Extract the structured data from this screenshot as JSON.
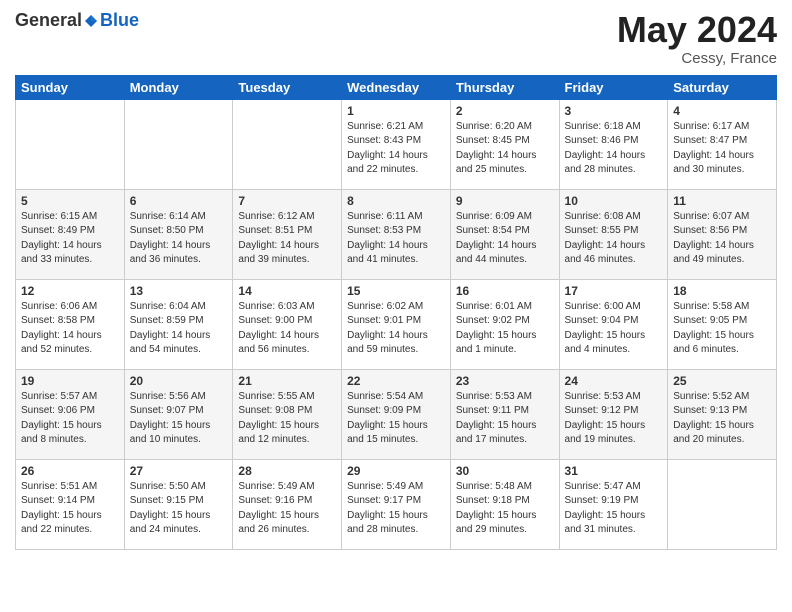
{
  "header": {
    "logo_general": "General",
    "logo_blue": "Blue",
    "month_year": "May 2024",
    "location": "Cessy, France"
  },
  "days_of_week": [
    "Sunday",
    "Monday",
    "Tuesday",
    "Wednesday",
    "Thursday",
    "Friday",
    "Saturday"
  ],
  "weeks": [
    [
      {
        "day": "",
        "info": ""
      },
      {
        "day": "",
        "info": ""
      },
      {
        "day": "",
        "info": ""
      },
      {
        "day": "1",
        "info": "Sunrise: 6:21 AM\nSunset: 8:43 PM\nDaylight: 14 hours\nand 22 minutes."
      },
      {
        "day": "2",
        "info": "Sunrise: 6:20 AM\nSunset: 8:45 PM\nDaylight: 14 hours\nand 25 minutes."
      },
      {
        "day": "3",
        "info": "Sunrise: 6:18 AM\nSunset: 8:46 PM\nDaylight: 14 hours\nand 28 minutes."
      },
      {
        "day": "4",
        "info": "Sunrise: 6:17 AM\nSunset: 8:47 PM\nDaylight: 14 hours\nand 30 minutes."
      }
    ],
    [
      {
        "day": "5",
        "info": "Sunrise: 6:15 AM\nSunset: 8:49 PM\nDaylight: 14 hours\nand 33 minutes."
      },
      {
        "day": "6",
        "info": "Sunrise: 6:14 AM\nSunset: 8:50 PM\nDaylight: 14 hours\nand 36 minutes."
      },
      {
        "day": "7",
        "info": "Sunrise: 6:12 AM\nSunset: 8:51 PM\nDaylight: 14 hours\nand 39 minutes."
      },
      {
        "day": "8",
        "info": "Sunrise: 6:11 AM\nSunset: 8:53 PM\nDaylight: 14 hours\nand 41 minutes."
      },
      {
        "day": "9",
        "info": "Sunrise: 6:09 AM\nSunset: 8:54 PM\nDaylight: 14 hours\nand 44 minutes."
      },
      {
        "day": "10",
        "info": "Sunrise: 6:08 AM\nSunset: 8:55 PM\nDaylight: 14 hours\nand 46 minutes."
      },
      {
        "day": "11",
        "info": "Sunrise: 6:07 AM\nSunset: 8:56 PM\nDaylight: 14 hours\nand 49 minutes."
      }
    ],
    [
      {
        "day": "12",
        "info": "Sunrise: 6:06 AM\nSunset: 8:58 PM\nDaylight: 14 hours\nand 52 minutes."
      },
      {
        "day": "13",
        "info": "Sunrise: 6:04 AM\nSunset: 8:59 PM\nDaylight: 14 hours\nand 54 minutes."
      },
      {
        "day": "14",
        "info": "Sunrise: 6:03 AM\nSunset: 9:00 PM\nDaylight: 14 hours\nand 56 minutes."
      },
      {
        "day": "15",
        "info": "Sunrise: 6:02 AM\nSunset: 9:01 PM\nDaylight: 14 hours\nand 59 minutes."
      },
      {
        "day": "16",
        "info": "Sunrise: 6:01 AM\nSunset: 9:02 PM\nDaylight: 15 hours\nand 1 minute."
      },
      {
        "day": "17",
        "info": "Sunrise: 6:00 AM\nSunset: 9:04 PM\nDaylight: 15 hours\nand 4 minutes."
      },
      {
        "day": "18",
        "info": "Sunrise: 5:58 AM\nSunset: 9:05 PM\nDaylight: 15 hours\nand 6 minutes."
      }
    ],
    [
      {
        "day": "19",
        "info": "Sunrise: 5:57 AM\nSunset: 9:06 PM\nDaylight: 15 hours\nand 8 minutes."
      },
      {
        "day": "20",
        "info": "Sunrise: 5:56 AM\nSunset: 9:07 PM\nDaylight: 15 hours\nand 10 minutes."
      },
      {
        "day": "21",
        "info": "Sunrise: 5:55 AM\nSunset: 9:08 PM\nDaylight: 15 hours\nand 12 minutes."
      },
      {
        "day": "22",
        "info": "Sunrise: 5:54 AM\nSunset: 9:09 PM\nDaylight: 15 hours\nand 15 minutes."
      },
      {
        "day": "23",
        "info": "Sunrise: 5:53 AM\nSunset: 9:11 PM\nDaylight: 15 hours\nand 17 minutes."
      },
      {
        "day": "24",
        "info": "Sunrise: 5:53 AM\nSunset: 9:12 PM\nDaylight: 15 hours\nand 19 minutes."
      },
      {
        "day": "25",
        "info": "Sunrise: 5:52 AM\nSunset: 9:13 PM\nDaylight: 15 hours\nand 20 minutes."
      }
    ],
    [
      {
        "day": "26",
        "info": "Sunrise: 5:51 AM\nSunset: 9:14 PM\nDaylight: 15 hours\nand 22 minutes."
      },
      {
        "day": "27",
        "info": "Sunrise: 5:50 AM\nSunset: 9:15 PM\nDaylight: 15 hours\nand 24 minutes."
      },
      {
        "day": "28",
        "info": "Sunrise: 5:49 AM\nSunset: 9:16 PM\nDaylight: 15 hours\nand 26 minutes."
      },
      {
        "day": "29",
        "info": "Sunrise: 5:49 AM\nSunset: 9:17 PM\nDaylight: 15 hours\nand 28 minutes."
      },
      {
        "day": "30",
        "info": "Sunrise: 5:48 AM\nSunset: 9:18 PM\nDaylight: 15 hours\nand 29 minutes."
      },
      {
        "day": "31",
        "info": "Sunrise: 5:47 AM\nSunset: 9:19 PM\nDaylight: 15 hours\nand 31 minutes."
      },
      {
        "day": "",
        "info": ""
      }
    ]
  ]
}
